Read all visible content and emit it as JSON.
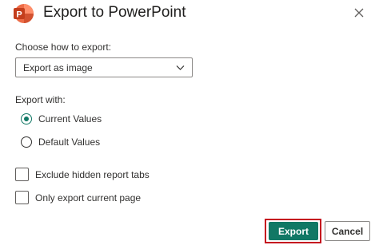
{
  "dialog": {
    "title": "Export to PowerPoint",
    "app_icon": "powerpoint-icon",
    "close_icon": "close-icon"
  },
  "export_method": {
    "label": "Choose how to export:",
    "selected_value": "Export as image",
    "chevron_icon": "chevron-down-icon"
  },
  "export_with": {
    "label": "Export with:",
    "options": [
      {
        "label": "Current Values",
        "checked": true
      },
      {
        "label": "Default Values",
        "checked": false
      }
    ]
  },
  "checkboxes": [
    {
      "label": "Exclude hidden report tabs",
      "checked": false
    },
    {
      "label": "Only export current page",
      "checked": false
    }
  ],
  "buttons": {
    "export_label": "Export",
    "cancel_label": "Cancel"
  },
  "colors": {
    "accent": "#117865",
    "highlight": "#c50f1f",
    "powerpoint_orange": "#c43e1c"
  }
}
